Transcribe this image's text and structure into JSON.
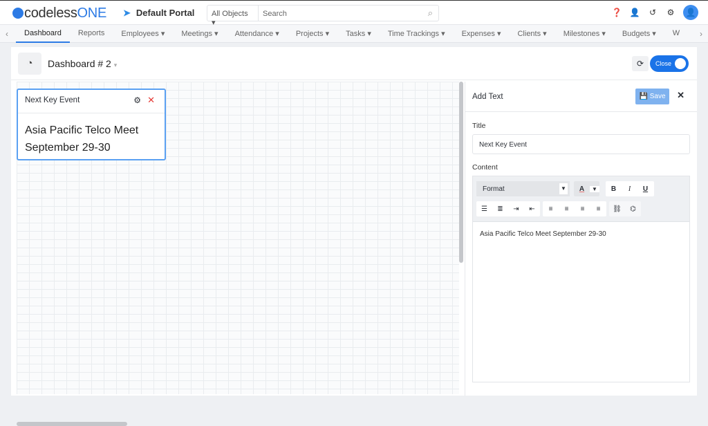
{
  "app": {
    "logo_prefix": "codeless",
    "logo_suffix": "ONE",
    "portal": "Default Portal",
    "search_scope": "All Objects",
    "search_placeholder": "Search"
  },
  "nav": {
    "items": [
      {
        "label": "Dashboard",
        "active": true
      },
      {
        "label": "Reports"
      },
      {
        "label": "Employees ▾"
      },
      {
        "label": "Meetings ▾"
      },
      {
        "label": "Attendance ▾"
      },
      {
        "label": "Projects ▾"
      },
      {
        "label": "Tasks ▾"
      },
      {
        "label": "Time Trackings ▾"
      },
      {
        "label": "Expenses ▾"
      },
      {
        "label": "Clients ▾"
      },
      {
        "label": "Milestones ▾"
      },
      {
        "label": "Budgets ▾"
      },
      {
        "label": "W"
      }
    ]
  },
  "dashboard": {
    "title": "Dashboard # 2",
    "toggle_label": "Close"
  },
  "widget": {
    "title": "Next Key Event",
    "content_line1": "Asia Pacific Telco Meet",
    "content_line2": "September 29-30"
  },
  "panel": {
    "title": "Add Text",
    "save_label": "Save",
    "title_label": "Title",
    "title_value": "Next Key Event",
    "content_label": "Content",
    "format_label": "Format",
    "content_value": "Asia Pacific Telco Meet September 29-30"
  },
  "colors": {
    "accent": "#1a73e8",
    "close_x": "#e53935"
  }
}
